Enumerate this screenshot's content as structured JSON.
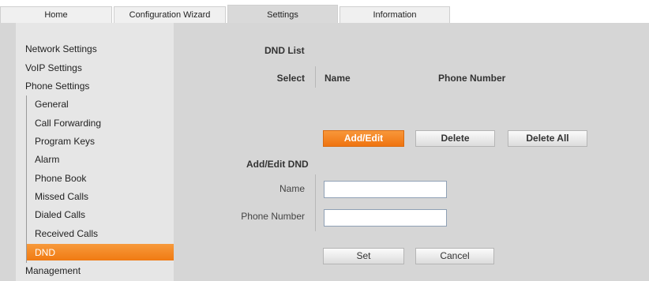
{
  "tabs": [
    {
      "label": "Home"
    },
    {
      "label": "Configuration Wizard"
    },
    {
      "label": "Settings",
      "active": true
    },
    {
      "label": "Information"
    }
  ],
  "sidebar": {
    "items": [
      {
        "label": "Network Settings"
      },
      {
        "label": "VoIP Settings"
      },
      {
        "label": "Phone Settings"
      }
    ],
    "phone_settings_children": [
      {
        "label": "General"
      },
      {
        "label": "Call Forwarding"
      },
      {
        "label": "Program Keys"
      },
      {
        "label": "Alarm"
      },
      {
        "label": "Phone Book"
      },
      {
        "label": "Missed Calls"
      },
      {
        "label": "Dialed Calls"
      },
      {
        "label": "Received Calls"
      },
      {
        "label": "DND",
        "active": true
      }
    ],
    "bottom_item": {
      "label": "Management"
    }
  },
  "dnd_list": {
    "heading": "DND List",
    "select_label": "Select",
    "col_name": "Name",
    "col_phone": "Phone Number",
    "buttons": {
      "add_edit": "Add/Edit",
      "delete": "Delete",
      "delete_all": "Delete All"
    }
  },
  "add_edit_dnd": {
    "heading": "Add/Edit DND",
    "name_label": "Name",
    "name_value": "",
    "phone_label": "Phone Number",
    "phone_value": "",
    "buttons": {
      "set": "Set",
      "cancel": "Cancel"
    }
  },
  "colors": {
    "accent": "#f07a12",
    "panel": "#d6d6d6",
    "sidebar": "#e6e6e6"
  }
}
